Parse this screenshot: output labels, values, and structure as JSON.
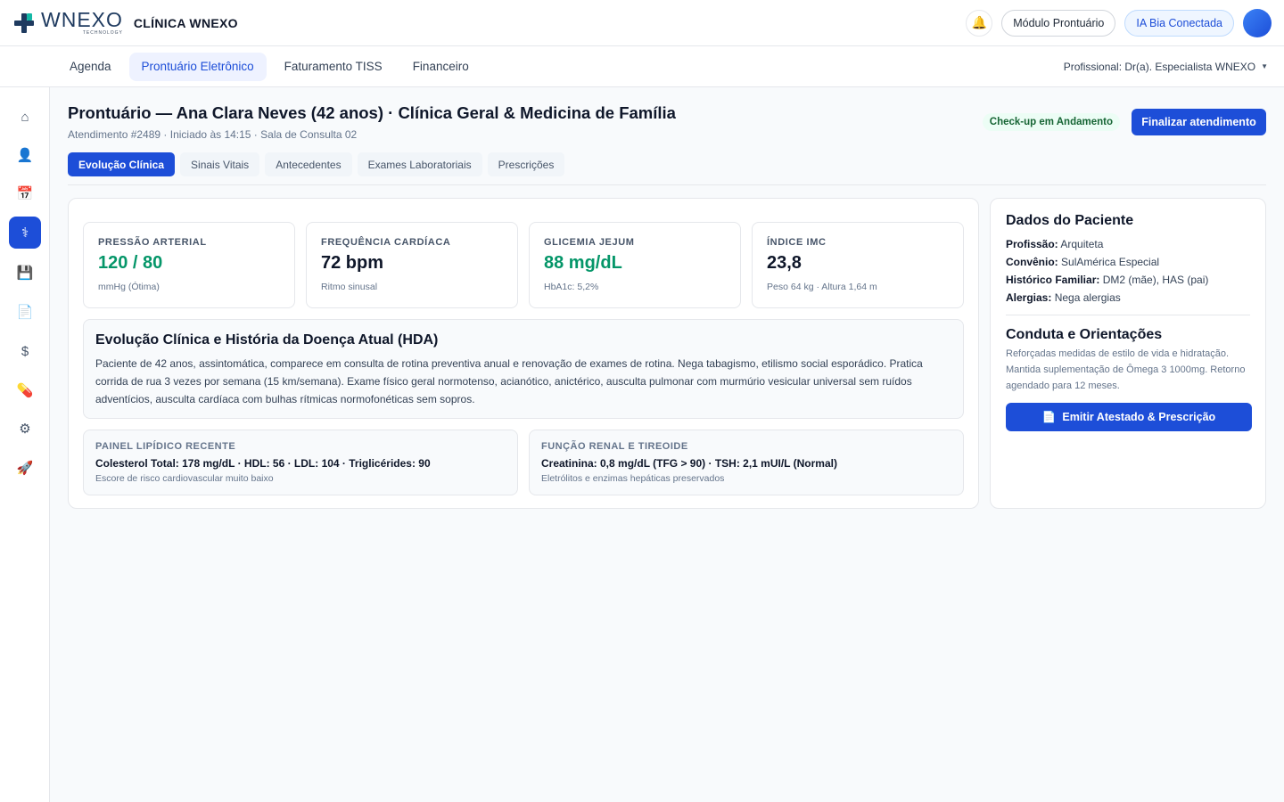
{
  "brand": {
    "logo_word": "WNEXO",
    "logo_sub": "TECHNOLOGY",
    "clinic_name": "CLÍNICA WNEXO"
  },
  "header": {
    "module_label": "Módulo Prontuário",
    "ia_label": "IA Bia Conectada",
    "bell_icon": "bell-icon"
  },
  "nav": {
    "items": [
      {
        "label": "Agenda"
      },
      {
        "label": "Prontuário Eletrônico",
        "active": true
      },
      {
        "label": "Faturamento TISS"
      },
      {
        "label": "Financeiro"
      }
    ],
    "professional": "Profissional: Dr(a). Especialista WNEXO"
  },
  "sidebar": {
    "items": [
      {
        "icon": "home-icon",
        "glyph": "⌂"
      },
      {
        "icon": "user-icon",
        "glyph": "👤"
      },
      {
        "icon": "calendar-icon",
        "glyph": "📅"
      },
      {
        "icon": "stethoscope-icon",
        "glyph": "⚕",
        "active": true
      },
      {
        "icon": "save-icon",
        "glyph": "💾"
      },
      {
        "icon": "document-icon",
        "glyph": "📄"
      },
      {
        "icon": "dollar-icon",
        "glyph": "$"
      },
      {
        "icon": "pill-icon",
        "glyph": "💊"
      },
      {
        "icon": "settings-icon",
        "glyph": "⚙"
      },
      {
        "icon": "rocket-icon",
        "glyph": "🚀"
      }
    ]
  },
  "record": {
    "title": "Prontuário — Ana Clara Neves (42 anos) · Clínica Geral & Medicina de Família",
    "subtitle": "Atendimento #2489 · Iniciado às 14:15 · Sala de Consulta 02",
    "status": "Check-up em Andamento",
    "finish_label": "Finalizar atendimento",
    "tabs": [
      {
        "label": "Evolução Clínica",
        "active": true
      },
      {
        "label": "Sinais Vitais"
      },
      {
        "label": "Antecedentes"
      },
      {
        "label": "Exames Laboratoriais"
      },
      {
        "label": "Prescrições"
      }
    ]
  },
  "vitals": [
    {
      "label": "Pressão Arterial",
      "value": "120 / 80",
      "note": "mmHg (Ótima)",
      "color": "#059669"
    },
    {
      "label": "Frequência Cardíaca",
      "value": "72 bpm",
      "note": "Ritmo sinusal",
      "color": "#0f172a"
    },
    {
      "label": "Glicemia Jejum",
      "value": "88 mg/dL",
      "note": "HbA1c: 5,2%",
      "color": "#059669"
    },
    {
      "label": "Índice IMC",
      "value": "23,8",
      "note": "Peso 64 kg · Altura 1,64 m",
      "color": "#0f172a"
    }
  ],
  "hda": {
    "title": "Evolução Clínica e História da Doença Atual (HDA)",
    "text": "Paciente de 42 anos, assintomática, comparece em consulta de rotina preventiva anual e renovação de exames de rotina. Nega tabagismo, etilismo social esporádico. Pratica corrida de rua 3 vezes por semana (15 km/semana). Exame físico geral normotenso, acianótico, anictérico, ausculta pulmonar com murmúrio vesicular universal sem ruídos adventícios, ausculta cardíaca com bulhas rítmicas normofonéticas sem sopros."
  },
  "labs": [
    {
      "label": "Painel Lipídico Recente",
      "value": "Colesterol Total: 178 mg/dL · HDL: 56 · LDL: 104 · Triglicérides: 90",
      "note": "Escore de risco cardiovascular muito baixo"
    },
    {
      "label": "Função Renal e Tireoide",
      "value": "Creatinina: 0,8 mg/dL (TFG > 90) · TSH: 2,1 mUI/L (Normal)",
      "note": "Eletrólitos e enzimas hepáticas preservados"
    }
  ],
  "patient": {
    "title": "Dados do Paciente",
    "rows": [
      {
        "label": "Profissão:",
        "value": "Arquiteta"
      },
      {
        "label": "Convênio:",
        "value": "SulAmérica Especial"
      },
      {
        "label": "Histórico Familiar:",
        "value": "DM2 (mãe), HAS (pai)"
      },
      {
        "label": "Alergias:",
        "value": "Nega alergias"
      }
    ],
    "conduta_title": "Conduta e Orientações",
    "conduta_text": "Reforçadas medidas de estilo de vida e hidratação. Mantida suplementação de Ômega 3 1000mg. Retorno agendado para 12 meses.",
    "emit_label": "Emitir Atestado & Prescrição"
  }
}
